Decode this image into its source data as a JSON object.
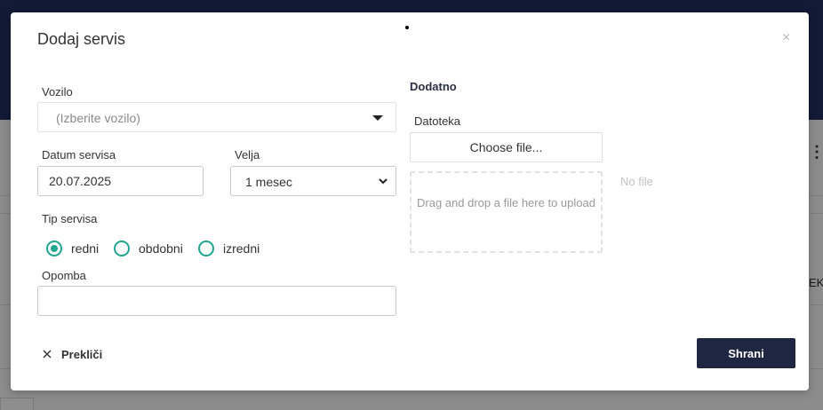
{
  "background": {
    "right_fragment": "EKA"
  },
  "modal": {
    "title": "Dodaj servis",
    "close_glyph": "×",
    "vozilo": {
      "label": "Vozilo",
      "placeholder": "(Izberite vozilo)"
    },
    "datum_servisa": {
      "label": "Datum servisa",
      "value": "20.07.2025"
    },
    "velja": {
      "label": "Velja",
      "selected": "1 mesec"
    },
    "tip_servisa": {
      "label": "Tip servisa",
      "options": [
        {
          "label": "redni",
          "checked": true
        },
        {
          "label": "obdobni",
          "checked": false
        },
        {
          "label": "izredni",
          "checked": false
        }
      ]
    },
    "opomba": {
      "label": "Opomba",
      "value": ""
    },
    "dodatno": {
      "heading": "Dodatno",
      "datoteka_label": "Datoteka",
      "choose_file": "Choose file...",
      "dropzone_text": "Drag and drop a file here to upload",
      "no_file": "No file"
    },
    "cancel_label": "Prekliči",
    "save_label": "Shrani"
  },
  "colors": {
    "accent": "#20a58e",
    "primary_button": "#1f2642",
    "header": "#131a36"
  }
}
